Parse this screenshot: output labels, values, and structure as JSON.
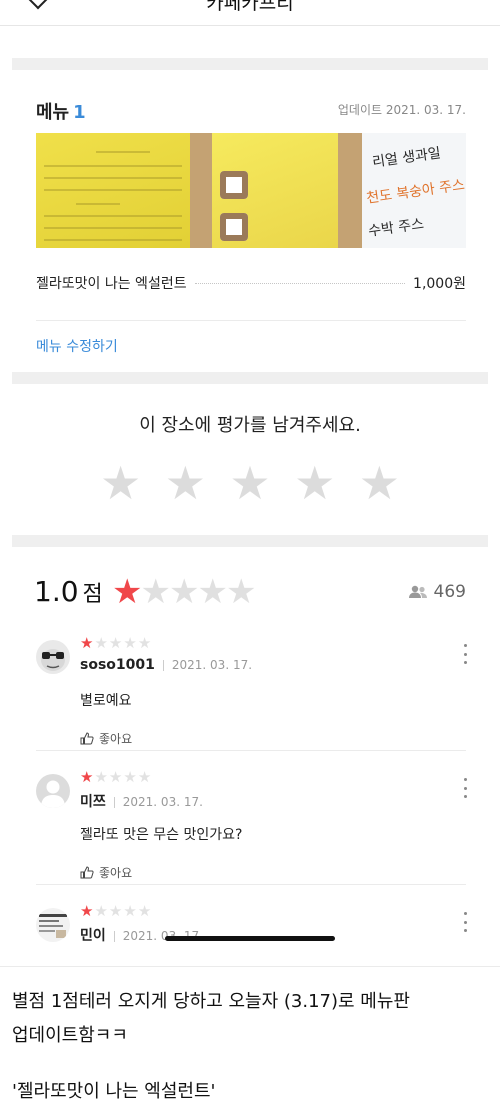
{
  "header": {
    "title": "카페카프리"
  },
  "menu": {
    "heading": "메뉴",
    "count": "1",
    "updated": "업데이트 2021. 03. 17.",
    "photo_text": [
      "리얼 생과일",
      "천도 복숭아 주스",
      "수박 주스"
    ],
    "items": [
      {
        "name": "젤라또맛이 나는 엑설런트",
        "price": "1,000원"
      }
    ],
    "edit_link": "메뉴 수정하기"
  },
  "rate": {
    "prompt": "이 장소에 평가를 남겨주세요.",
    "star_glyph": "★",
    "max_stars": 5
  },
  "summary": {
    "score": "1.0",
    "unit": "점",
    "rating": 1,
    "people_count": "469",
    "star_color": "#f0474a"
  },
  "reviews": [
    {
      "author": "soso1001",
      "date": "2021. 03. 17.",
      "rating": 1,
      "body": "별로예요",
      "like": "좋아요"
    },
    {
      "author": "미쯔",
      "date": "2021. 03. 17.",
      "rating": 1,
      "body": "젤라또 맛은 무슨 맛인가요?",
      "like": "좋아요"
    },
    {
      "author": "민이",
      "date": "2021. 03. 17",
      "rating": 1
    }
  ],
  "caption": {
    "line1": "별점 1점테러 오지게 당하고 오늘자 (3.17)로 메뉴판",
    "line2": "업데이트함ㅋㅋ",
    "line3": "'젤라또맛이 나는 엑설런트'"
  },
  "colors": {
    "accent_blue": "#3a8bd9",
    "star_red": "#f0474a",
    "star_gray": "#dcdcdc"
  }
}
